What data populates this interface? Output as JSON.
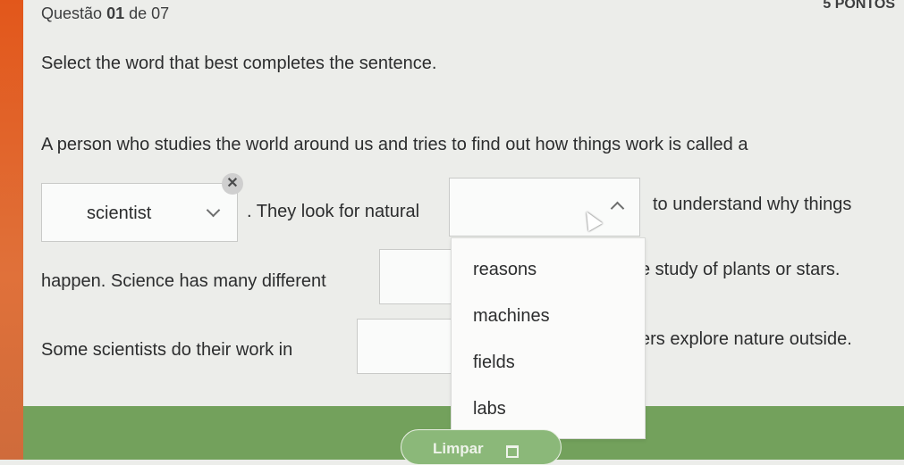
{
  "header": {
    "question_prefix": "Questão",
    "question_number": "01",
    "question_suffix": "de 07",
    "points": "5 PONTOS"
  },
  "instruction": "Select the word that best completes the sentence.",
  "passage": {
    "line1": "A person who studies the world around us and tries to find out how things work is called a",
    "line2_after_dropdown1": ". They look for natural",
    "line2_after_dropdown2": "to understand why things",
    "line3_start": "happen. Science has many different",
    "line3_end": "e study of plants or stars.",
    "line4_start": "Some scientists do their work in",
    "line4_end": "ers explore nature outside."
  },
  "dropdown1": {
    "selected": "scientist"
  },
  "dropdown2": {
    "selected": ""
  },
  "dropdown_options": [
    "reasons",
    "machines",
    "fields",
    "labs"
  ],
  "footer": {
    "clear_label": "Limpar"
  },
  "colors": {
    "accent_strip": "#e2571b",
    "footer_bar": "#73a15c"
  }
}
